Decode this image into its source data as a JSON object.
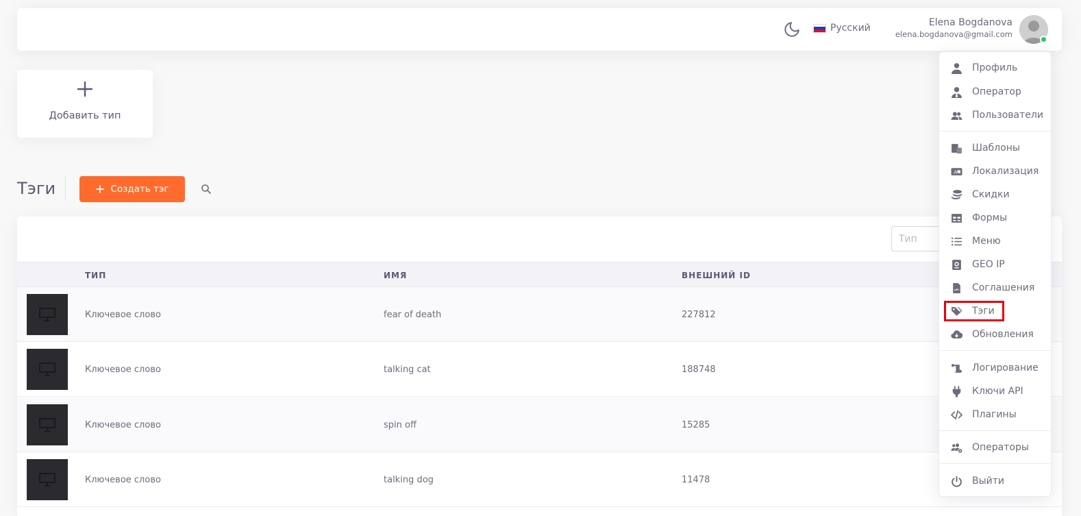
{
  "header": {
    "theme_icon": "moon-icon",
    "language": {
      "label": "Русский",
      "flag": "flag-ru-icon"
    },
    "user": {
      "name": "Elena Bogdanova",
      "email": "elena.bogdanova@gmail.com",
      "status_color": "#28c76f"
    }
  },
  "add_type": {
    "label": "Добавить тип",
    "icon": "plus-icon"
  },
  "page": {
    "title": "Тэги",
    "create_button": "Создать тэг",
    "accent_color": "#ff6b2c"
  },
  "table": {
    "filter_placeholder": "Тип",
    "columns": [
      "ТИП",
      "ИМЯ",
      "ВНЕШНИЙ ID"
    ],
    "rows": [
      {
        "type": "Ключевое слово",
        "name": "fear of death",
        "external_id": "227812"
      },
      {
        "type": "Ключевое слово",
        "name": "talking cat",
        "external_id": "188748"
      },
      {
        "type": "Ключевое слово",
        "name": "spin off",
        "external_id": "15285"
      },
      {
        "type": "Ключевое слово",
        "name": "talking dog",
        "external_id": "11478"
      }
    ]
  },
  "menu": {
    "items": [
      {
        "label": "Профиль",
        "icon": "user-icon"
      },
      {
        "label": "Оператор",
        "icon": "user-tie-icon"
      },
      {
        "label": "Пользователи",
        "icon": "users-icon"
      },
      {
        "label": "Шаблоны",
        "icon": "templates-icon"
      },
      {
        "label": "Локализация",
        "icon": "localization-icon"
      },
      {
        "label": "Скидки",
        "icon": "coins-icon"
      },
      {
        "label": "Формы",
        "icon": "table-icon"
      },
      {
        "label": "Меню",
        "icon": "list-icon"
      },
      {
        "label": "GEO IP",
        "icon": "passport-icon"
      },
      {
        "label": "Соглашения",
        "icon": "contract-icon"
      },
      {
        "label": "Тэги",
        "icon": "tags-icon"
      },
      {
        "label": "Обновления",
        "icon": "cloud-download-icon"
      },
      {
        "label": "Логирование",
        "icon": "scroll-icon"
      },
      {
        "label": "Ключи API",
        "icon": "plug-icon"
      },
      {
        "label": "Плагины",
        "icon": "code-icon"
      },
      {
        "label": "Операторы",
        "icon": "users-cog-icon"
      },
      {
        "label": "Выйти",
        "icon": "power-icon"
      }
    ],
    "highlight_color": "#e8000d"
  }
}
